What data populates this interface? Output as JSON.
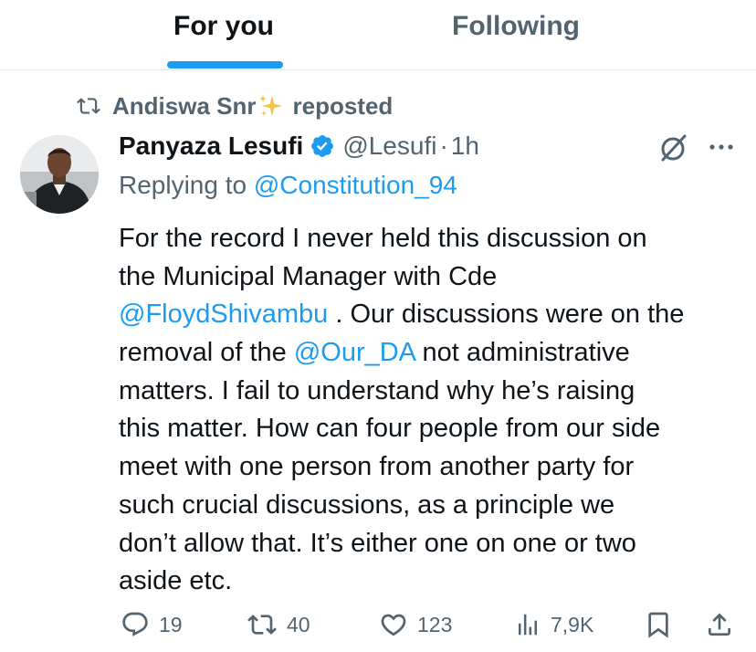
{
  "tabs": [
    {
      "label": "For you",
      "active": true
    },
    {
      "label": "Following",
      "active": false
    }
  ],
  "repost": {
    "icon": "repost-icon",
    "name": "Andiswa Snr",
    "emoji": "✨",
    "suffix": "reposted"
  },
  "tweet": {
    "author_name": "Panyaza Lesufi",
    "verified": true,
    "handle": "@Lesufi",
    "separator": "·",
    "time": "1h",
    "reply_prefix": "Replying to",
    "reply_to": "@Constitution_94",
    "body": {
      "line1": "For the record I never held this discussion on",
      "line2": "the Municipal Manager with Cde",
      "mention1": "@FloydShivambu",
      "line3_rest": " . Our discussions were on the",
      "line4_pre": "removal of the ",
      "mention2": "@Our_DA",
      "line4_post": " not administrative",
      "line5": "matters. I fail to understand why he’s raising",
      "line6": "this matter. How can four people from our side",
      "line7": "meet with one person from another party for",
      "line8": "such crucial discussions, as a principle we",
      "line9": "don’t allow that. It’s either one on one or two",
      "line10": "aside etc."
    }
  },
  "actions": {
    "replies": "19",
    "reposts": "40",
    "likes": "123",
    "views": "7,9K"
  },
  "colors": {
    "accent": "#1d9bf0",
    "text": "#0f1419",
    "secondary": "#536471",
    "divider": "#e6e9ec"
  }
}
